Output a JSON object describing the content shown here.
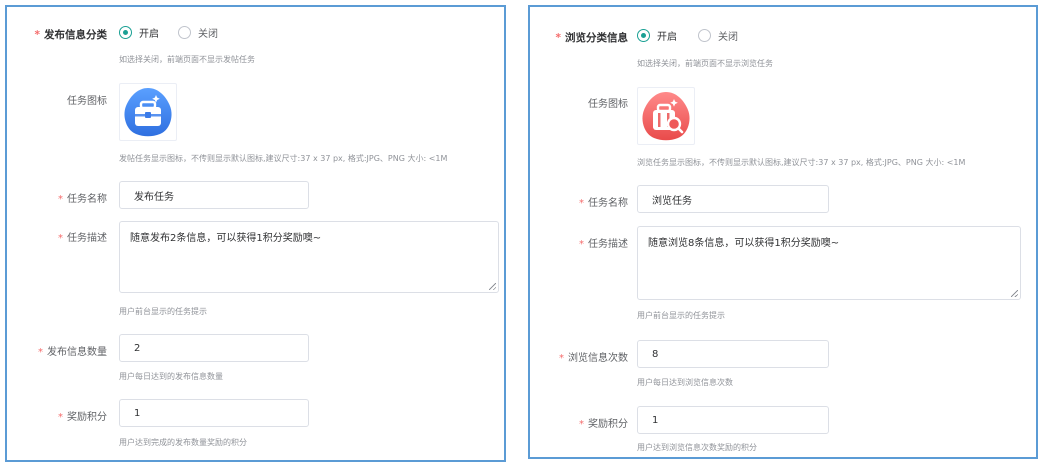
{
  "left": {
    "category": {
      "label": "发布信息分类",
      "opt_on": "开启",
      "opt_off": "关闭",
      "selected": "开启",
      "hint": "如选择关闭，前端页面不显示发帖任务"
    },
    "icon": {
      "label": "任务图标",
      "hint": "发帖任务显示图标，不传则显示默认图标,建议尺寸:37 x 37 px, 格式:JPG、PNG 大小: <1M",
      "image": "post-task-icon"
    },
    "name": {
      "label": "任务名称",
      "value": "发布任务"
    },
    "desc": {
      "label": "任务描述",
      "value": "随意发布2条信息，可以获得1积分奖励噢~",
      "hint": "用户前台显示的任务提示"
    },
    "count": {
      "label": "发布信息数量",
      "value": "2",
      "hint": "用户每日达到的发布信息数量"
    },
    "points": {
      "label": "奖励积分",
      "value": "1",
      "hint": "用户达到完成的发布数量奖励的积分"
    }
  },
  "right": {
    "category": {
      "label": "浏览分类信息",
      "opt_on": "开启",
      "opt_off": "关闭",
      "selected": "开启",
      "hint": "如选择关闭，前端页面不显示浏览任务"
    },
    "icon": {
      "label": "任务图标",
      "hint": "浏览任务显示图标，不传则显示默认图标,建议尺寸:37 x 37 px, 格式:JPG、PNG 大小: <1M",
      "image": "browse-task-icon"
    },
    "name": {
      "label": "任务名称",
      "value": "浏览任务"
    },
    "desc": {
      "label": "任务描述",
      "value": "随意浏览8条信息，可以获得1积分奖励噢~",
      "hint": "用户前台显示的任务提示"
    },
    "count": {
      "label": "浏览信息次数",
      "value": "8",
      "hint": "用户每日达到浏览信息次数"
    },
    "points": {
      "label": "奖励积分",
      "value": "1",
      "hint": "用户达到浏览信息次数奖励的积分"
    }
  },
  "colors": {
    "accent": "#1aa094",
    "required": "#f56c6c",
    "frame": "#5b9bd5",
    "icon_blue": "#3b7be8",
    "icon_red": "#ee5a5a"
  }
}
